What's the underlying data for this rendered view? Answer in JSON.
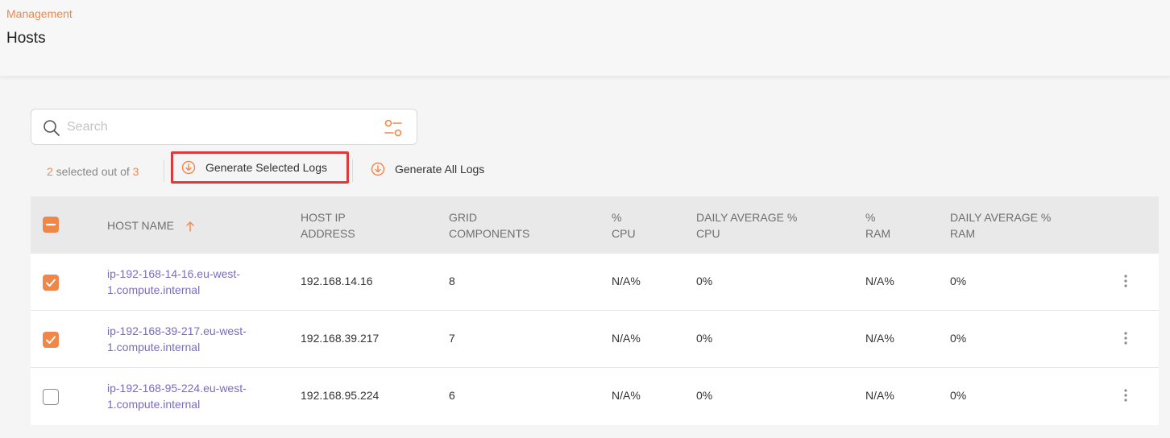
{
  "header": {
    "breadcrumb": "Management",
    "title": "Hosts"
  },
  "search": {
    "placeholder": "Search",
    "value": ""
  },
  "selection": {
    "selected": "2",
    "text_middle": " selected out of ",
    "total": "3"
  },
  "actions": {
    "generate_selected": "Generate Selected Logs",
    "generate_all": "Generate All Logs"
  },
  "table": {
    "columns": {
      "host_name": "HOST NAME",
      "host_ip_1": "HOST IP",
      "host_ip_2": "ADDRESS",
      "grid_1": "GRID",
      "grid_2": "COMPONENTS",
      "cpu_1": "%",
      "cpu_2": "CPU",
      "daily_cpu_1": "DAILY AVERAGE %",
      "daily_cpu_2": "CPU",
      "ram_1": "%",
      "ram_2": "RAM",
      "daily_ram_1": "DAILY AVERAGE %",
      "daily_ram_2": "RAM"
    },
    "rows": [
      {
        "selected": true,
        "host_line1": "ip-192-168-14-16.eu-west-",
        "host_line2": "1.compute.internal",
        "ip": "192.168.14.16",
        "grid": "8",
        "cpu": "N/A%",
        "daily_cpu": "0%",
        "ram": "N/A%",
        "daily_ram": "0%"
      },
      {
        "selected": true,
        "host_line1": "ip-192-168-39-217.eu-west-",
        "host_line2": "1.compute.internal",
        "ip": "192.168.39.217",
        "grid": "7",
        "cpu": "N/A%",
        "daily_cpu": "0%",
        "ram": "N/A%",
        "daily_ram": "0%"
      },
      {
        "selected": false,
        "host_line1": "ip-192-168-95-224.eu-west-",
        "host_line2": "1.compute.internal",
        "ip": "192.168.95.224",
        "grid": "6",
        "cpu": "N/A%",
        "daily_cpu": "0%",
        "ram": "N/A%",
        "daily_ram": "0%"
      }
    ]
  },
  "colors": {
    "accent": "#f0874a",
    "link": "#7b6bbf",
    "highlight_border": "#d93c3c"
  }
}
